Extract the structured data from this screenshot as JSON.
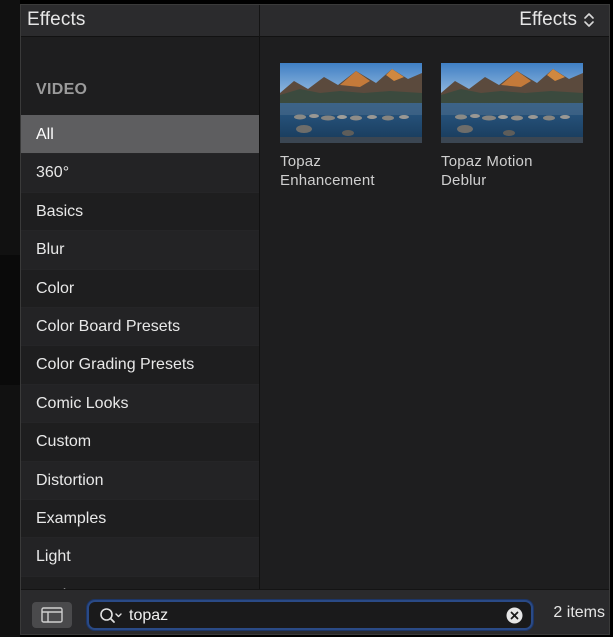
{
  "header": {
    "title": "Effects",
    "browser_label": "Effects"
  },
  "sidebar": {
    "section_label": "VIDEO",
    "items": [
      {
        "label": "All",
        "selected": true
      },
      {
        "label": "360°"
      },
      {
        "label": "Basics"
      },
      {
        "label": "Blur"
      },
      {
        "label": "Color"
      },
      {
        "label": "Color Board Presets"
      },
      {
        "label": "Color Grading Presets"
      },
      {
        "label": "Comic Looks"
      },
      {
        "label": "Custom"
      },
      {
        "label": "Distortion"
      },
      {
        "label": "Examples"
      },
      {
        "label": "Light"
      },
      {
        "label": "Looks"
      }
    ]
  },
  "content": {
    "tiles": [
      {
        "label_line1": "Topaz",
        "label_line2": "Enhancement",
        "thumbnail_icon": "mountain-lake-thumbnail"
      },
      {
        "label_line1": "Topaz Motion",
        "label_line2": "Deblur",
        "thumbnail_icon": "mountain-lake-thumbnail"
      }
    ]
  },
  "footer": {
    "search_value": "topaz",
    "item_count": "2 items"
  },
  "colors": {
    "panel_bg": "#1e1e1f",
    "selected_row": "#5e5e60",
    "search_focus": "#2a4a86"
  }
}
